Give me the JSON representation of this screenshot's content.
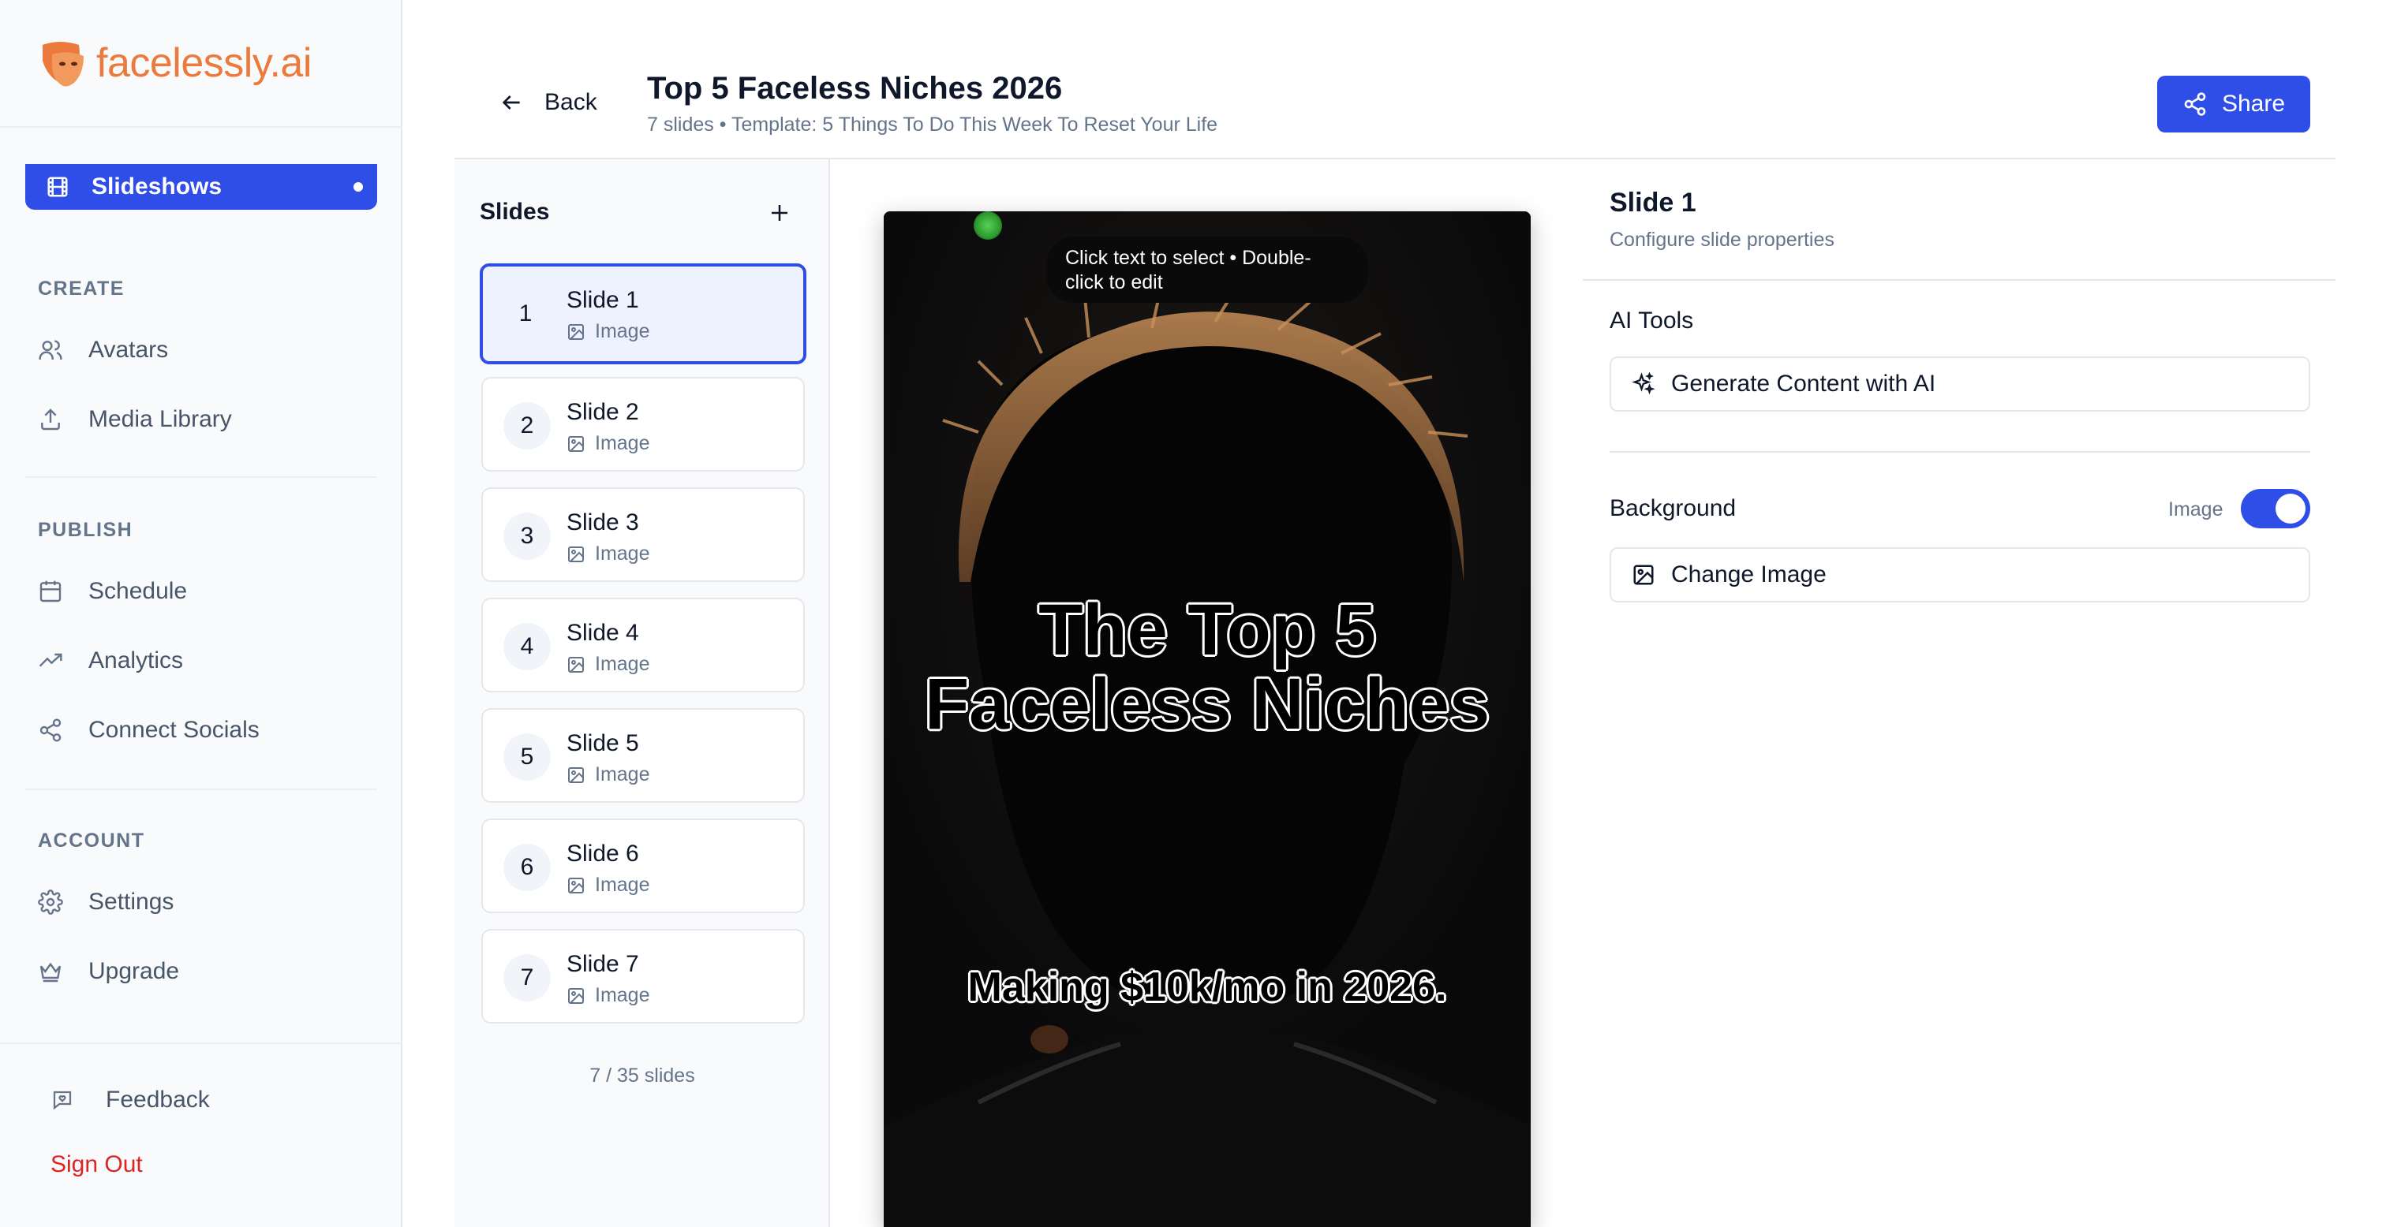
{
  "brand": {
    "name": "facelessly.ai",
    "color": "#ec7a3c",
    "accent": "#2f4ee8"
  },
  "sidebar": {
    "active_item": {
      "label": "Slideshows",
      "icon": "film-icon"
    },
    "sections": [
      {
        "title": "CREATE",
        "items": [
          {
            "label": "Avatars",
            "icon": "users-icon"
          },
          {
            "label": "Media Library",
            "icon": "upload-icon"
          }
        ]
      },
      {
        "title": "PUBLISH",
        "items": [
          {
            "label": "Schedule",
            "icon": "calendar-icon"
          },
          {
            "label": "Analytics",
            "icon": "trending-up-icon"
          },
          {
            "label": "Connect Socials",
            "icon": "share-icon"
          }
        ]
      },
      {
        "title": "ACCOUNT",
        "items": [
          {
            "label": "Settings",
            "icon": "gear-icon"
          },
          {
            "label": "Upgrade",
            "icon": "crown-icon"
          }
        ]
      }
    ],
    "feedback_label": "Feedback",
    "signout_label": "Sign Out"
  },
  "header": {
    "back_label": "Back",
    "title": "Top 5 Faceless Niches 2026",
    "subtitle": "7 slides • Template: 5 Things To Do This Week To Reset Your Life",
    "share_label": "Share"
  },
  "slides_panel": {
    "title": "Slides",
    "slides": [
      {
        "num": "1",
        "name": "Slide 1",
        "type": "Image"
      },
      {
        "num": "2",
        "name": "Slide 2",
        "type": "Image"
      },
      {
        "num": "3",
        "name": "Slide 3",
        "type": "Image"
      },
      {
        "num": "4",
        "name": "Slide 4",
        "type": "Image"
      },
      {
        "num": "5",
        "name": "Slide 5",
        "type": "Image"
      },
      {
        "num": "6",
        "name": "Slide 6",
        "type": "Image"
      },
      {
        "num": "7",
        "name": "Slide 7",
        "type": "Image"
      }
    ],
    "count_text": "7 / 35 slides"
  },
  "canvas": {
    "tooltip": "Click text to select • Double-click to edit",
    "headline": "The Top 5 Faceless Niches",
    "subline": "Making $10k/mo in 2026."
  },
  "properties": {
    "title": "Slide 1",
    "subtitle": "Configure slide properties",
    "ai_tools_label": "AI Tools",
    "generate_label": "Generate Content with AI",
    "background_label": "Background",
    "background_type": "Image",
    "background_toggle_on": true,
    "change_image_label": "Change Image"
  }
}
